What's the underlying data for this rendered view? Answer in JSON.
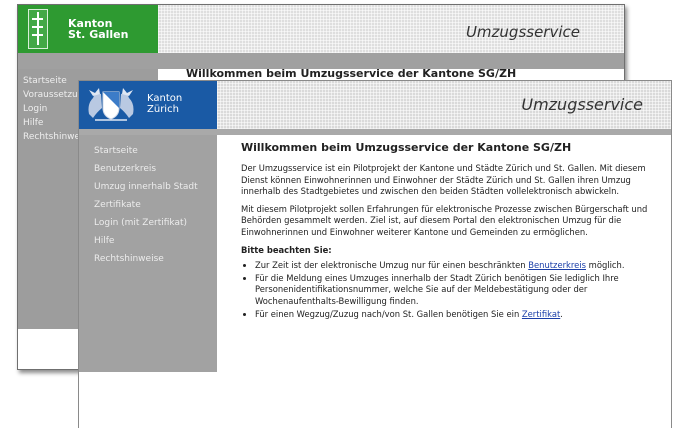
{
  "back_window": {
    "kanton_line1": "Kanton",
    "kanton_line2": "St. Gallen",
    "title": "Umzugsservice",
    "nav": [
      "Startseite",
      "Voraussetzungen",
      "Login",
      "Hilfe",
      "Rechtshinweise"
    ],
    "welcome": "Willkommen beim Umzugsservice der Kantone SG/ZH"
  },
  "front_window": {
    "kanton_line1": "Kanton",
    "kanton_line2": "Zürich",
    "title": "Umzugsservice",
    "nav": [
      "Startseite",
      "Benutzerkreis",
      "Umzug innerhalb Stadt",
      "Zertifikate",
      "Login (mit Zertifikat)",
      "Hilfe",
      "Rechtshinweise"
    ],
    "heading": "Willkommen beim Umzugsservice der Kantone SG/ZH",
    "paragraph1": "Der Umzugsservice ist ein Pilotprojekt der Kantone und Städte Zürich und St. Gallen. Mit diesem Dienst können Einwohnerinnen und Einwohner der Städte Zürich und St. Gallen ihren Umzug innerhalb des Stadtgebietes und zwischen den beiden Städten vollelektronisch abwickeln.",
    "paragraph2": "Mit diesem Pilotprojekt sollen Erfahrungen für elektronische Prozesse zwischen Bürgerschaft und Behörden gesammelt werden. Ziel ist, auf diesem Portal den elektronischen Umzug für die Einwohnerinnen und Einwohner weiterer Kantone und Gemeinden zu ermöglichen.",
    "note_heading": "Bitte beachten Sie:",
    "bullet1_text": "Zur Zeit ist der elektronische Umzug nur für einen beschränkten ",
    "bullet1_link": "Benutzerkreis",
    "bullet1_after": " möglich.",
    "bullet2": "Für die Meldung eines Umzuges innerhalb der Stadt Zürich benötigen Sie lediglich Ihre Personenidentifikationsnummer, welche Sie auf der Meldebestätigung oder der Wochenaufenthalts-Bewilligung finden.",
    "bullet3_text": "Für einen Wegzug/Zuzug nach/von St. Gallen benötigen Sie ein ",
    "bullet3_link": "Zertifikat",
    "bullet3_after": "."
  },
  "colors": {
    "sg_green": "#2e9a31",
    "zh_blue": "#1a5aa5",
    "nav_gray": "#a2a2a2",
    "link": "#1a3ea8"
  }
}
